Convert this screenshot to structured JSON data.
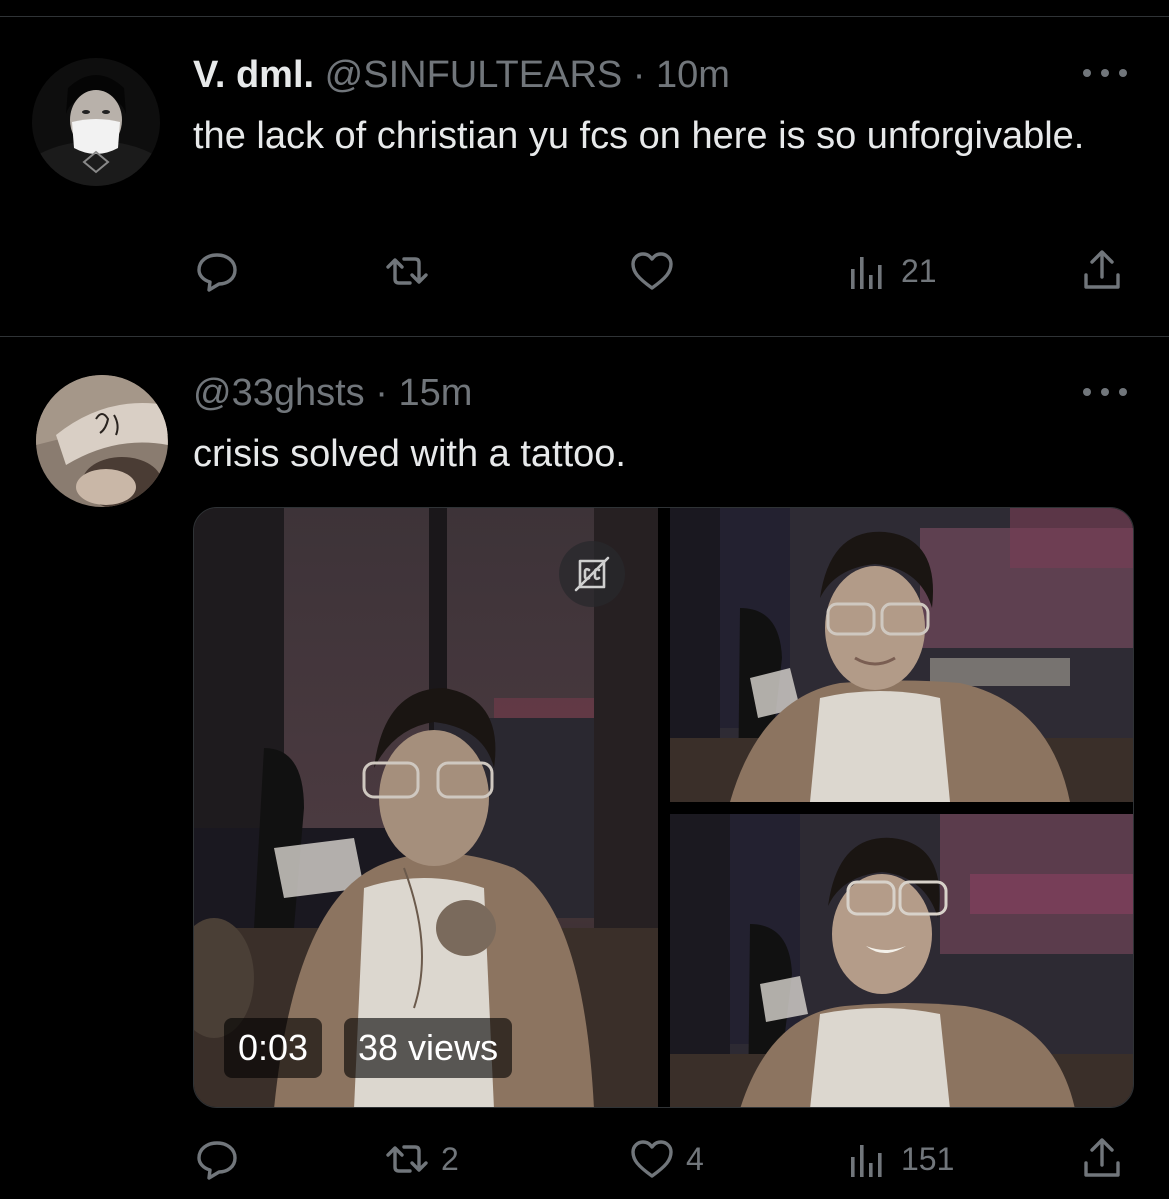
{
  "tweets": [
    {
      "display_name": "V. dml.",
      "handle": "@SINFULTEARS",
      "separator": "·",
      "time": "10m",
      "text": "the lack of christian yu fcs on here is so unforgivable.",
      "stats": {
        "replies": "",
        "retweets": "",
        "likes": "",
        "views": "21"
      }
    },
    {
      "display_name": "",
      "handle": "@33ghsts",
      "separator": "·",
      "time": "15m",
      "text": "crisis solved with a tattoo.",
      "media": {
        "video_duration": "0:03",
        "video_views": "38 views",
        "caption_icon": "closed-captions-off-icon"
      },
      "stats": {
        "replies": "",
        "retweets": "2",
        "likes": "4",
        "views": "151"
      }
    }
  ],
  "icons": {
    "reply": "reply-icon",
    "retweet": "retweet-icon",
    "like": "heart-icon",
    "views": "views-icon",
    "share": "share-icon",
    "more": "more-icon"
  },
  "colors": {
    "background": "#000000",
    "text": "#e7e9ea",
    "muted": "#71767b",
    "divider": "#2f3336"
  }
}
